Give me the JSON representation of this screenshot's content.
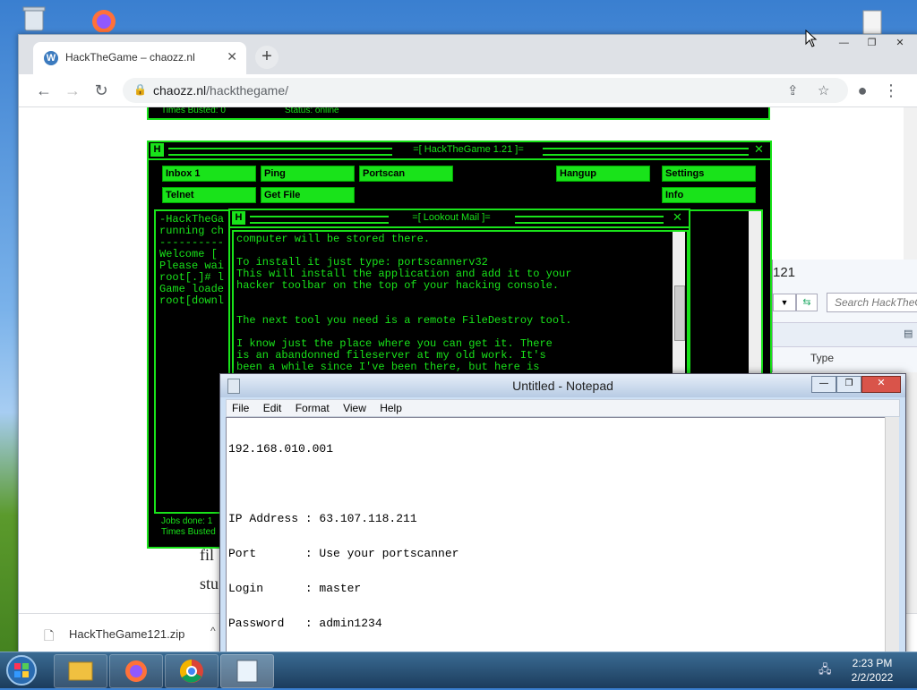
{
  "browser": {
    "tab_title": "HackTheGame – chaozz.nl",
    "url_domain": "chaozz.nl",
    "url_path": "/hackthegame/",
    "download_filename": "HackTheGame121.zip"
  },
  "behind_window": {
    "title_fragment": "121",
    "search_placeholder": "Search HackTheG",
    "column_type": "Type"
  },
  "page_text": {
    "frag1": "fil",
    "frag2": "stu"
  },
  "game": {
    "top_status_left": "Times Busted: 0",
    "top_status_right": "Status: online",
    "title": "=[ HackTheGame 1.21 ]=",
    "buttons_row1": [
      "Inbox 1",
      "Ping",
      "Portscan",
      "Hangup",
      "Settings"
    ],
    "buttons_row2": [
      "Telnet",
      "Get File",
      "Info"
    ],
    "console_lines": [
      "-HackTheGa",
      "running ch",
      "----------",
      "",
      "Welcome [ ",
      "Please wai",
      "",
      "root[.]# l",
      "",
      "Game loade",
      "",
      "root[downl"
    ],
    "bottom_left_1": "Jobs done: 1",
    "bottom_left_2": "Times Busted",
    "mail_title": "=[ Lookout Mail ]=",
    "mail_lines": [
      "computer will be stored there.",
      "",
      "To install it just type: portscannerv32",
      "This will install the application and add it to your",
      "hacker toolbar on the top of your hacking console.",
      "",
      "",
      "The next tool you need is a remote FileDestroy tool.",
      "",
      "I know just the place where you can get it. There",
      "is an abandonned fileserver at my old work. It's",
      "been a while since I've been there, but here is"
    ]
  },
  "notepad": {
    "title": "Untitled - Notepad",
    "menu": [
      "File",
      "Edit",
      "Format",
      "View",
      "Help"
    ],
    "lines": [
      "192.168.010.001",
      "",
      "IP Address : 63.107.118.211",
      "Port       : Use your portscanner",
      "Login      : master",
      "Password   : admin1234"
    ]
  },
  "taskbar": {
    "time": "2:23 PM",
    "date": "2/2/2022"
  },
  "colors": {
    "hack_green": "#19e31a",
    "notepad_frame": "#cde0f5"
  }
}
